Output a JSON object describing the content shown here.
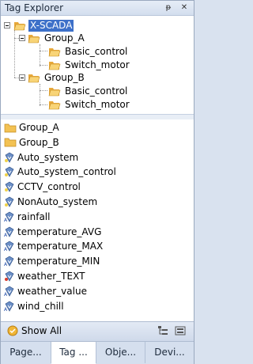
{
  "window": {
    "title": "Tag Explorer",
    "pin_glyph": "ᵽ",
    "close_glyph": "✕"
  },
  "tree": {
    "root": "X-SCADA",
    "groups": [
      {
        "label": "Group_A",
        "children": [
          "Basic_control",
          "Switch_motor"
        ]
      },
      {
        "label": "Group_B",
        "children": [
          "Basic_control",
          "Switch_motor"
        ]
      }
    ]
  },
  "list": {
    "items": [
      {
        "label": "Group_A",
        "icon": "folder-icon"
      },
      {
        "label": "Group_B",
        "icon": "folder-icon"
      },
      {
        "label": "Auto_system",
        "icon": "tag-digital-icon"
      },
      {
        "label": "Auto_system_control",
        "icon": "tag-digital-icon"
      },
      {
        "label": "CCTV_control",
        "icon": "tag-digital-icon"
      },
      {
        "label": "NonAuto_system",
        "icon": "tag-digital-icon"
      },
      {
        "label": "rainfall",
        "icon": "tag-analog-icon"
      },
      {
        "label": "temperature_AVG",
        "icon": "tag-analog-icon"
      },
      {
        "label": "temperature_MAX",
        "icon": "tag-analog-icon"
      },
      {
        "label": "temperature_MIN",
        "icon": "tag-analog-icon"
      },
      {
        "label": "weather_TEXT",
        "icon": "tag-text-icon"
      },
      {
        "label": "weather_value",
        "icon": "tag-analog-icon"
      },
      {
        "label": "wind_chill",
        "icon": "tag-analog-icon"
      }
    ]
  },
  "bottombar": {
    "show_all": "Show All"
  },
  "tabs": [
    "Page...",
    "Tag ...",
    "Obje...",
    "Devi..."
  ],
  "colors": {
    "selection": "#3d70c9",
    "folder": "#f3c253"
  }
}
